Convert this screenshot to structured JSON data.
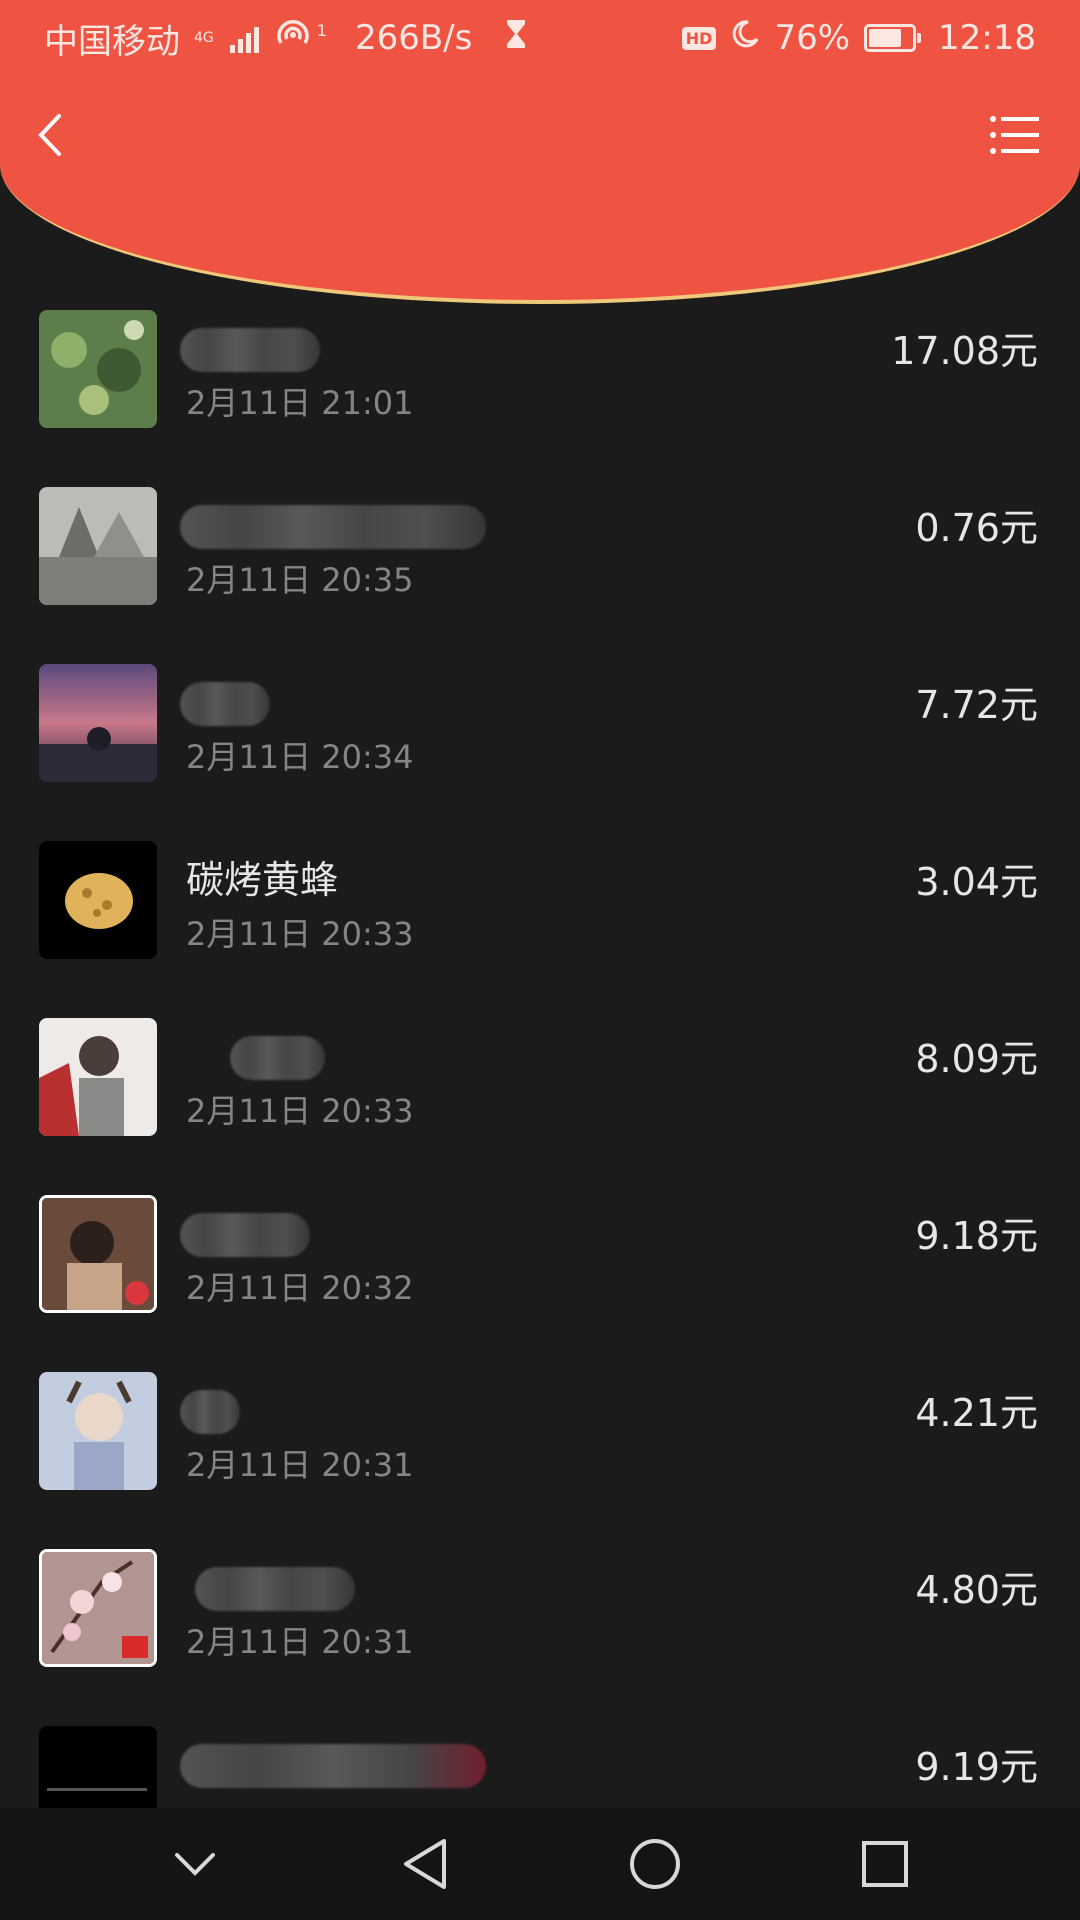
{
  "status_bar": {
    "carrier": "中国移动",
    "network_gen": "4G",
    "hotspot_badge": "1",
    "speed": "266B/s",
    "hd_badge": "HD",
    "battery_percent": "76%",
    "time": "12:18"
  },
  "records": [
    {
      "name": "",
      "time": "2月11日  21:01",
      "amount": "17.08元"
    },
    {
      "name": "",
      "time": "2月11日  20:35",
      "amount": "0.76元"
    },
    {
      "name": "",
      "time": "2月11日  20:34",
      "amount": "7.72元"
    },
    {
      "name": "碳烤黄蜂",
      "time": "2月11日  20:33",
      "amount": "3.04元"
    },
    {
      "name": "",
      "time": "2月11日  20:33",
      "amount": "8.09元"
    },
    {
      "name": "",
      "time": "2月11日  20:32",
      "amount": "9.18元"
    },
    {
      "name": "",
      "time": "2月11日  20:31",
      "amount": "4.21元"
    },
    {
      "name": "",
      "time": "2月11日  20:31",
      "amount": "4.80元"
    },
    {
      "name": "",
      "time": "",
      "amount": "9.19元"
    }
  ],
  "icons": {
    "back": "chevron-left-icon",
    "menu": "list-menu-icon",
    "nav_collapse": "chevron-down-icon",
    "nav_back": "triangle-back-icon",
    "nav_home": "circle-home-icon",
    "nav_recent": "square-recent-icon"
  },
  "colors": {
    "header": "#ef5442",
    "header_border": "#f0c87a",
    "background": "#1b1b1b",
    "amount_text": "#e6e6e6",
    "time_text": "#858585"
  }
}
